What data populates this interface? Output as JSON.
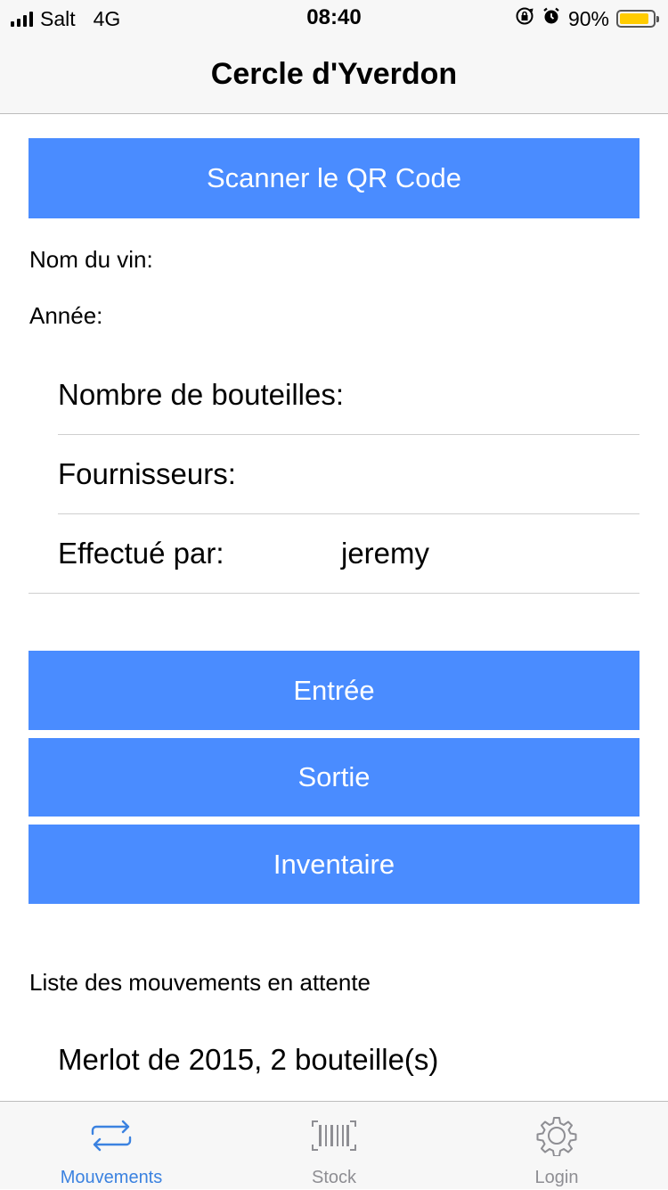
{
  "status_bar": {
    "carrier": "Salt",
    "network": "4G",
    "time": "08:40",
    "battery_pct": "90%",
    "battery_level": 0.9,
    "battery_color": "#ffcc00"
  },
  "nav": {
    "title": "Cercle d'Yverdon"
  },
  "scan": {
    "label": "Scanner le QR Code"
  },
  "info": {
    "wine_name_label": "Nom du vin:",
    "year_label": "Année:"
  },
  "form": {
    "bottles_label": "Nombre de bouteilles:",
    "suppliers_label": "Fournisseurs:",
    "done_by_label": "Effectué par:",
    "done_by_value": "jeremy"
  },
  "actions": {
    "entry": "Entrée",
    "exit": "Sortie",
    "inventory": "Inventaire"
  },
  "pending": {
    "title": "Liste des mouvements en attente",
    "items": [
      "Merlot de 2015, 2 bouteille(s)"
    ]
  },
  "tabs": [
    {
      "label": "Mouvements",
      "icon": "transfer-arrows-icon",
      "active": true
    },
    {
      "label": "Stock",
      "icon": "barcode-icon",
      "active": false
    },
    {
      "label": "Login",
      "icon": "gear-icon",
      "active": false
    }
  ],
  "colors": {
    "accent": "#4a8cff",
    "tab_active": "#3b82e0",
    "tab_inactive": "#8e8e93"
  }
}
